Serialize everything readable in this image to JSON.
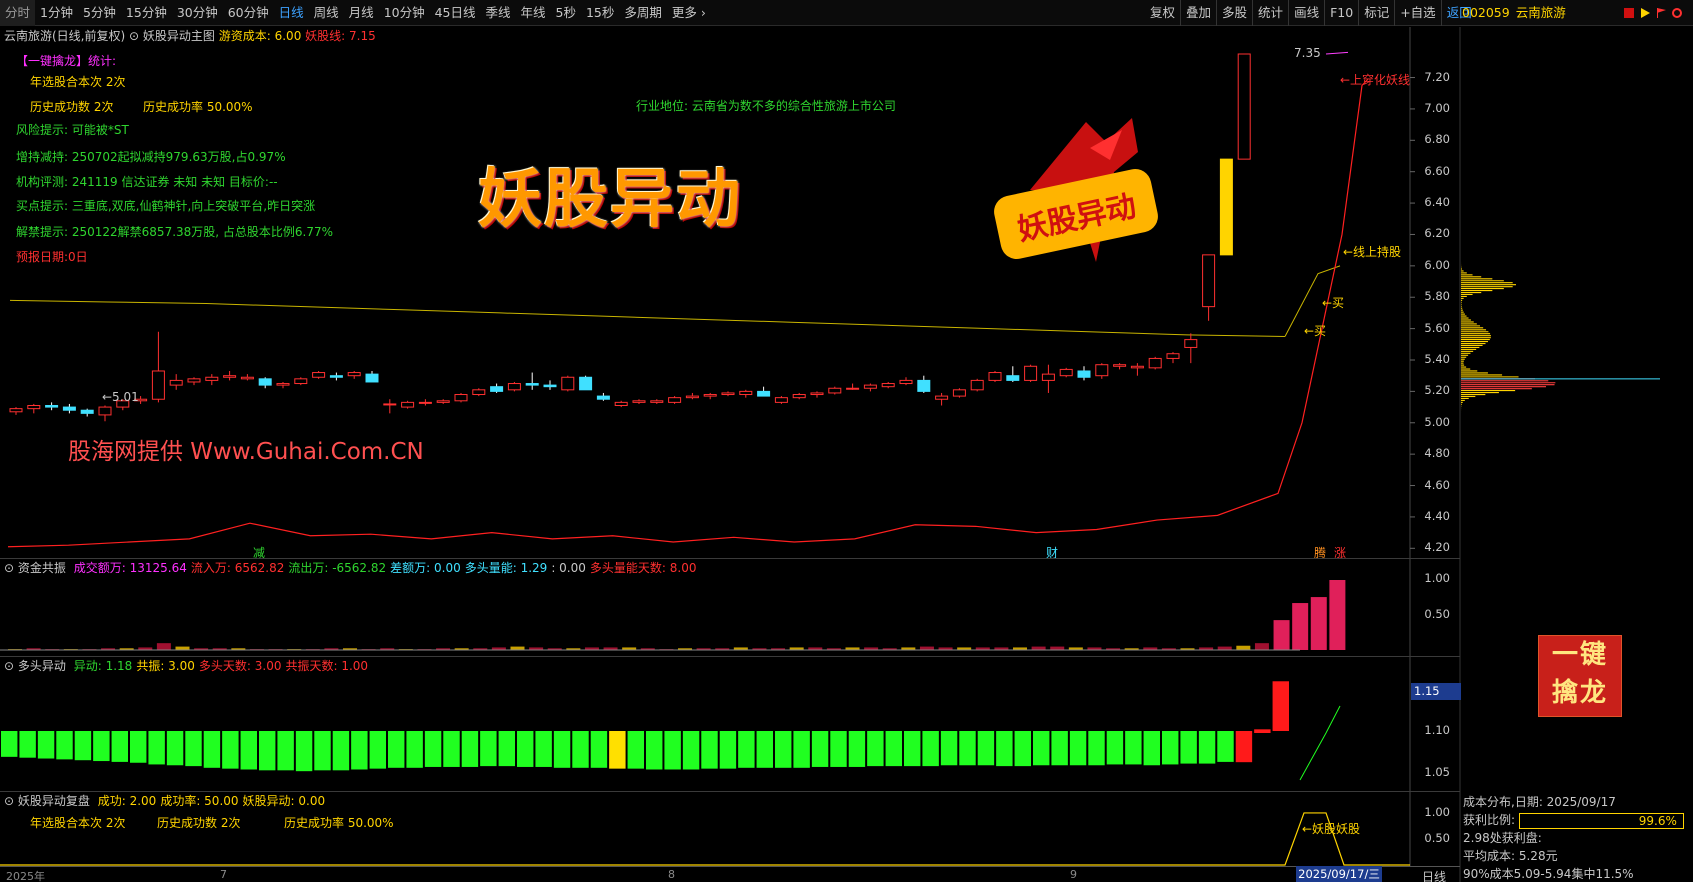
{
  "toolbar": {
    "tabs": [
      "分时",
      "1分钟",
      "5分钟",
      "15分钟",
      "30分钟",
      "60分钟",
      "日线",
      "周线",
      "月线",
      "10分钟",
      "45日线",
      "季线",
      "年线",
      "5秒",
      "15秒",
      "多周期",
      "更多 ›"
    ],
    "active_tab": "日线",
    "tools": [
      "复权",
      "叠加",
      "多股",
      "统计",
      "画线",
      "F10",
      "标记",
      "+自选",
      "返回"
    ]
  },
  "stock": {
    "code": "002059",
    "name": "云南旅游"
  },
  "main_panel": {
    "title": "云南旅游(日线,前复权)",
    "indicator": "妖股异动主图",
    "cost_label": "游资成本: 6.00",
    "yaogu_line": "妖股线: 7.15",
    "stats_title": "【一键擒龙】统计:",
    "year_count": "年选股合本次 2次",
    "hist_success": "历史成功数 2次",
    "hist_rate": "历史成功率 50.00%",
    "risk": "风险提示: 可能被*ST",
    "holding_change": "增持减持: 250702起拟减持979.63万股,占0.97%",
    "rating": "机构评测: 241119 信达证券 未知 未知 目标价:--",
    "buy_hint": "买点提示: 三重底,双底,仙鹤神针,向上突破平台,昨日突涨",
    "unlock": "解禁提示: 250122解禁6857.38万股, 占总股本比例6.77%",
    "forecast": "预报日期:0日",
    "industry": "行业地位: 云南省为数不多的综合性旅游上市公司",
    "brand": "妖股异动",
    "watermark": "股海网提供 Www.Guhai.Com.CN",
    "high_label": "7.35",
    "low_label": "←5.01",
    "annotations": [
      "←上穿化妖线",
      "←线上持股",
      "←买",
      "←买"
    ],
    "markers": [
      "减",
      "财",
      "腾",
      "涨"
    ],
    "y_ticks": [
      "7.20",
      "7.00",
      "6.80",
      "6.60",
      "6.40",
      "6.20",
      "6.00",
      "5.80",
      "5.60",
      "5.40",
      "5.20",
      "5.00",
      "4.80",
      "4.60",
      "4.40",
      "4.20"
    ]
  },
  "vol_panel": {
    "title": "资金共振",
    "items": [
      {
        "text": "成交额万: 13125.64",
        "color": "#ff30ff"
      },
      {
        "text": "流入万: 6562.82",
        "color": "#ff3030"
      },
      {
        "text": "流出万: -6562.82",
        "color": "#2fd52f"
      },
      {
        "text": "差额万: 0.00",
        "color": "#40e0ff"
      },
      {
        "text": "多头量能: 1.29",
        "color": "#40e0ff"
      },
      {
        "text": ": 0.00",
        "color": "#c8c8c8"
      },
      {
        "text": "多头量能天数: 8.00",
        "color": "#ff3030"
      }
    ],
    "y_ticks": [
      "1.00",
      "0.50"
    ]
  },
  "bull_panel": {
    "title": "多头异动",
    "items": [
      {
        "text": "异动: 1.18",
        "color": "#2fd52f"
      },
      {
        "text": "共振: 3.00",
        "color": "#ffd400"
      },
      {
        "text": "多头天数: 3.00",
        "color": "#ff3030"
      },
      {
        "text": "共振天数: 1.00",
        "color": "#ff3030"
      }
    ],
    "y_ticks": [
      "1.10",
      "1.05"
    ],
    "current": "1.15"
  },
  "review_panel": {
    "title": "妖股异动复盘",
    "items": [
      {
        "text": "成功: 2.00",
        "color": "#ffd400"
      },
      {
        "text": "成功率: 50.00",
        "color": "#ffd400"
      },
      {
        "text": "妖股异动: 0.00",
        "color": "#ffd400"
      }
    ],
    "year_count": "年选股合本次 2次",
    "hist_success": "历史成功数 2次",
    "hist_rate": "历史成功率 50.00%",
    "label": "←妖股妖股",
    "y_ticks": [
      "1.00",
      "0.50"
    ]
  },
  "date_axis": {
    "ticks": [
      "2025年",
      "7",
      "8",
      "9"
    ],
    "current": "2025/09/17/三",
    "period": "日线"
  },
  "side_panel": {
    "title": "成本分布,日期: 2025/09/17",
    "profit_label": "获利比例:",
    "profit_value": "99.6%",
    "profit_price": "2.98处获利盘:",
    "avg_cost": "平均成本: 5.28元",
    "concentration": "90%成本5.09-5.94集中11.5%",
    "grab_button": [
      "一键",
      "擒龙"
    ]
  },
  "colors": {
    "up": "#ff3030",
    "down": "#40e0ff",
    "ma": "#c8b400",
    "accent": "#3da2ff",
    "yellow": "#ffd400"
  },
  "chart_data": {
    "type": "candlestick",
    "title": "云南旅游(日线,前复权)",
    "candles": [
      [
        5.07,
        5.1,
        5.05,
        5.09
      ],
      [
        5.09,
        5.12,
        5.06,
        5.11
      ],
      [
        5.11,
        5.13,
        5.08,
        5.1
      ],
      [
        5.1,
        5.12,
        5.06,
        5.08
      ],
      [
        5.08,
        5.09,
        5.04,
        5.06
      ],
      [
        5.05,
        5.11,
        5.01,
        5.1
      ],
      [
        5.1,
        5.15,
        5.08,
        5.14
      ],
      [
        5.14,
        5.17,
        5.12,
        5.15
      ],
      [
        5.15,
        5.58,
        5.13,
        5.33
      ],
      [
        5.24,
        5.31,
        5.21,
        5.27
      ],
      [
        5.26,
        5.29,
        5.24,
        5.28
      ],
      [
        5.27,
        5.31,
        5.24,
        5.29
      ],
      [
        5.29,
        5.33,
        5.27,
        5.3
      ],
      [
        5.28,
        5.31,
        5.27,
        5.29
      ],
      [
        5.28,
        5.29,
        5.22,
        5.24
      ],
      [
        5.24,
        5.26,
        5.22,
        5.25
      ],
      [
        5.25,
        5.29,
        5.24,
        5.28
      ],
      [
        5.29,
        5.33,
        5.28,
        5.32
      ],
      [
        5.3,
        5.32,
        5.27,
        5.29
      ],
      [
        5.3,
        5.33,
        5.28,
        5.32
      ],
      [
        5.31,
        5.33,
        5.27,
        5.26
      ],
      [
        5.12,
        5.15,
        5.06,
        5.12
      ],
      [
        5.1,
        5.14,
        5.09,
        5.13
      ],
      [
        5.13,
        5.15,
        5.11,
        5.13
      ],
      [
        5.13,
        5.15,
        5.12,
        5.14
      ],
      [
        5.14,
        5.19,
        5.13,
        5.18
      ],
      [
        5.18,
        5.22,
        5.17,
        5.21
      ],
      [
        5.23,
        5.25,
        5.19,
        5.2
      ],
      [
        5.21,
        5.26,
        5.2,
        5.25
      ],
      [
        5.25,
        5.32,
        5.21,
        5.24
      ],
      [
        5.24,
        5.27,
        5.21,
        5.23
      ],
      [
        5.21,
        5.3,
        5.2,
        5.29
      ],
      [
        5.29,
        5.3,
        5.22,
        5.21
      ],
      [
        5.17,
        5.19,
        5.14,
        5.15
      ],
      [
        5.11,
        5.14,
        5.1,
        5.13
      ],
      [
        5.13,
        5.15,
        5.12,
        5.14
      ],
      [
        5.13,
        5.15,
        5.12,
        5.14
      ],
      [
        5.13,
        5.17,
        5.12,
        5.16
      ],
      [
        5.16,
        5.19,
        5.15,
        5.17
      ],
      [
        5.17,
        5.19,
        5.15,
        5.18
      ],
      [
        5.18,
        5.2,
        5.17,
        5.19
      ],
      [
        5.18,
        5.21,
        5.16,
        5.2
      ],
      [
        5.2,
        5.23,
        5.17,
        5.17
      ],
      [
        5.13,
        5.17,
        5.12,
        5.16
      ],
      [
        5.16,
        5.19,
        5.15,
        5.18
      ],
      [
        5.18,
        5.2,
        5.16,
        5.19
      ],
      [
        5.19,
        5.23,
        5.18,
        5.22
      ],
      [
        5.22,
        5.25,
        5.21,
        5.22
      ],
      [
        5.22,
        5.25,
        5.2,
        5.24
      ],
      [
        5.23,
        5.26,
        5.22,
        5.25
      ],
      [
        5.25,
        5.29,
        5.24,
        5.27
      ],
      [
        5.27,
        5.3,
        5.19,
        5.2
      ],
      [
        5.15,
        5.19,
        5.11,
        5.17
      ],
      [
        5.17,
        5.22,
        5.16,
        5.21
      ],
      [
        5.21,
        5.28,
        5.2,
        5.27
      ],
      [
        5.27,
        5.33,
        5.26,
        5.32
      ],
      [
        5.3,
        5.36,
        5.26,
        5.27
      ],
      [
        5.27,
        5.37,
        5.26,
        5.36
      ],
      [
        5.27,
        5.37,
        5.19,
        5.31
      ],
      [
        5.3,
        5.35,
        5.29,
        5.34
      ],
      [
        5.33,
        5.36,
        5.27,
        5.29
      ],
      [
        5.3,
        5.38,
        5.28,
        5.37
      ],
      [
        5.36,
        5.38,
        5.34,
        5.37
      ],
      [
        5.35,
        5.38,
        5.3,
        5.36
      ],
      [
        5.35,
        5.42,
        5.34,
        5.41
      ],
      [
        5.41,
        5.45,
        5.38,
        5.44
      ],
      [
        5.48,
        5.57,
        5.38,
        5.53
      ],
      [
        5.74,
        6.07,
        5.65,
        6.07
      ],
      [
        6.07,
        6.68,
        6.07,
        6.68
      ],
      [
        6.68,
        7.35,
        6.68,
        7.35
      ]
    ],
    "ma_line": [
      5.78,
      5.77,
      5.76,
      5.74,
      5.72,
      5.7,
      5.68,
      5.66,
      5.64,
      5.62,
      5.6,
      5.58,
      5.56,
      5.55
    ],
    "yaogu_line": [
      4.21,
      4.22,
      4.24,
      4.26,
      4.36,
      4.28,
      4.29,
      4.26,
      4.3,
      4.26,
      4.28,
      4.24,
      4.27,
      4.24,
      4.26,
      4.35,
      4.34,
      4.3,
      4.32,
      4.38,
      4.41,
      4.55,
      5.0,
      5.6,
      6.2,
      7.15
    ],
    "ylim": [
      4.1,
      7.35
    ],
    "volume": [
      0.01,
      0.02,
      0.01,
      0.01,
      0.01,
      0.02,
      0.02,
      0.03,
      0.08,
      0.04,
      0.02,
      0.02,
      0.02,
      0.01,
      0.01,
      0.01,
      0.01,
      0.02,
      0.02,
      0.01,
      0.02,
      0.01,
      0.01,
      0.02,
      0.02,
      0.02,
      0.03,
      0.04,
      0.03,
      0.02,
      0.02,
      0.03,
      0.03,
      0.03,
      0.02,
      0.01,
      0.02,
      0.02,
      0.02,
      0.03,
      0.02,
      0.02,
      0.03,
      0.03,
      0.02,
      0.03,
      0.03,
      0.02,
      0.03,
      0.04,
      0.03,
      0.03,
      0.03,
      0.03,
      0.03,
      0.04,
      0.04,
      0.03,
      0.03,
      0.02,
      0.02,
      0.03,
      0.02,
      0.02,
      0.03,
      0.04,
      0.05,
      0.08,
      0.35,
      0.55,
      0.62,
      0.82
    ],
    "bull": [
      1.099,
      1.098,
      1.097,
      1.096,
      1.095,
      1.094,
      1.093,
      1.092,
      1.09,
      1.089,
      1.088,
      1.086,
      1.085,
      1.084,
      1.083,
      1.083,
      1.082,
      1.083,
      1.083,
      1.084,
      1.085,
      1.086,
      1.086,
      1.087,
      1.087,
      1.087,
      1.088,
      1.088,
      1.087,
      1.087,
      1.086,
      1.086,
      1.086,
      1.085,
      1.085,
      1.084,
      1.084,
      1.084,
      1.085,
      1.085,
      1.086,
      1.086,
      1.086,
      1.086,
      1.087,
      1.087,
      1.087,
      1.088,
      1.088,
      1.088,
      1.088,
      1.089,
      1.089,
      1.089,
      1.088,
      1.088,
      1.089,
      1.089,
      1.089,
      1.089,
      1.09,
      1.09,
      1.089,
      1.09,
      1.091,
      1.091,
      1.093,
      1.092,
      1.111,
      1.155
    ],
    "bull_state": [
      "g",
      "g",
      "g",
      "g",
      "g",
      "g",
      "g",
      "g",
      "g",
      "g",
      "g",
      "g",
      "g",
      "g",
      "g",
      "g",
      "g",
      "g",
      "g",
      "g",
      "g",
      "g",
      "g",
      "g",
      "g",
      "g",
      "g",
      "g",
      "g",
      "g",
      "g",
      "g",
      "g",
      "y",
      "g",
      "g",
      "g",
      "g",
      "g",
      "g",
      "g",
      "g",
      "g",
      "g",
      "g",
      "g",
      "g",
      "g",
      "g",
      "g",
      "g",
      "g",
      "g",
      "g",
      "g",
      "g",
      "g",
      "g",
      "g",
      "g",
      "g",
      "g",
      "g",
      "g",
      "g",
      "g",
      "g",
      "r",
      "r",
      "r"
    ]
  }
}
